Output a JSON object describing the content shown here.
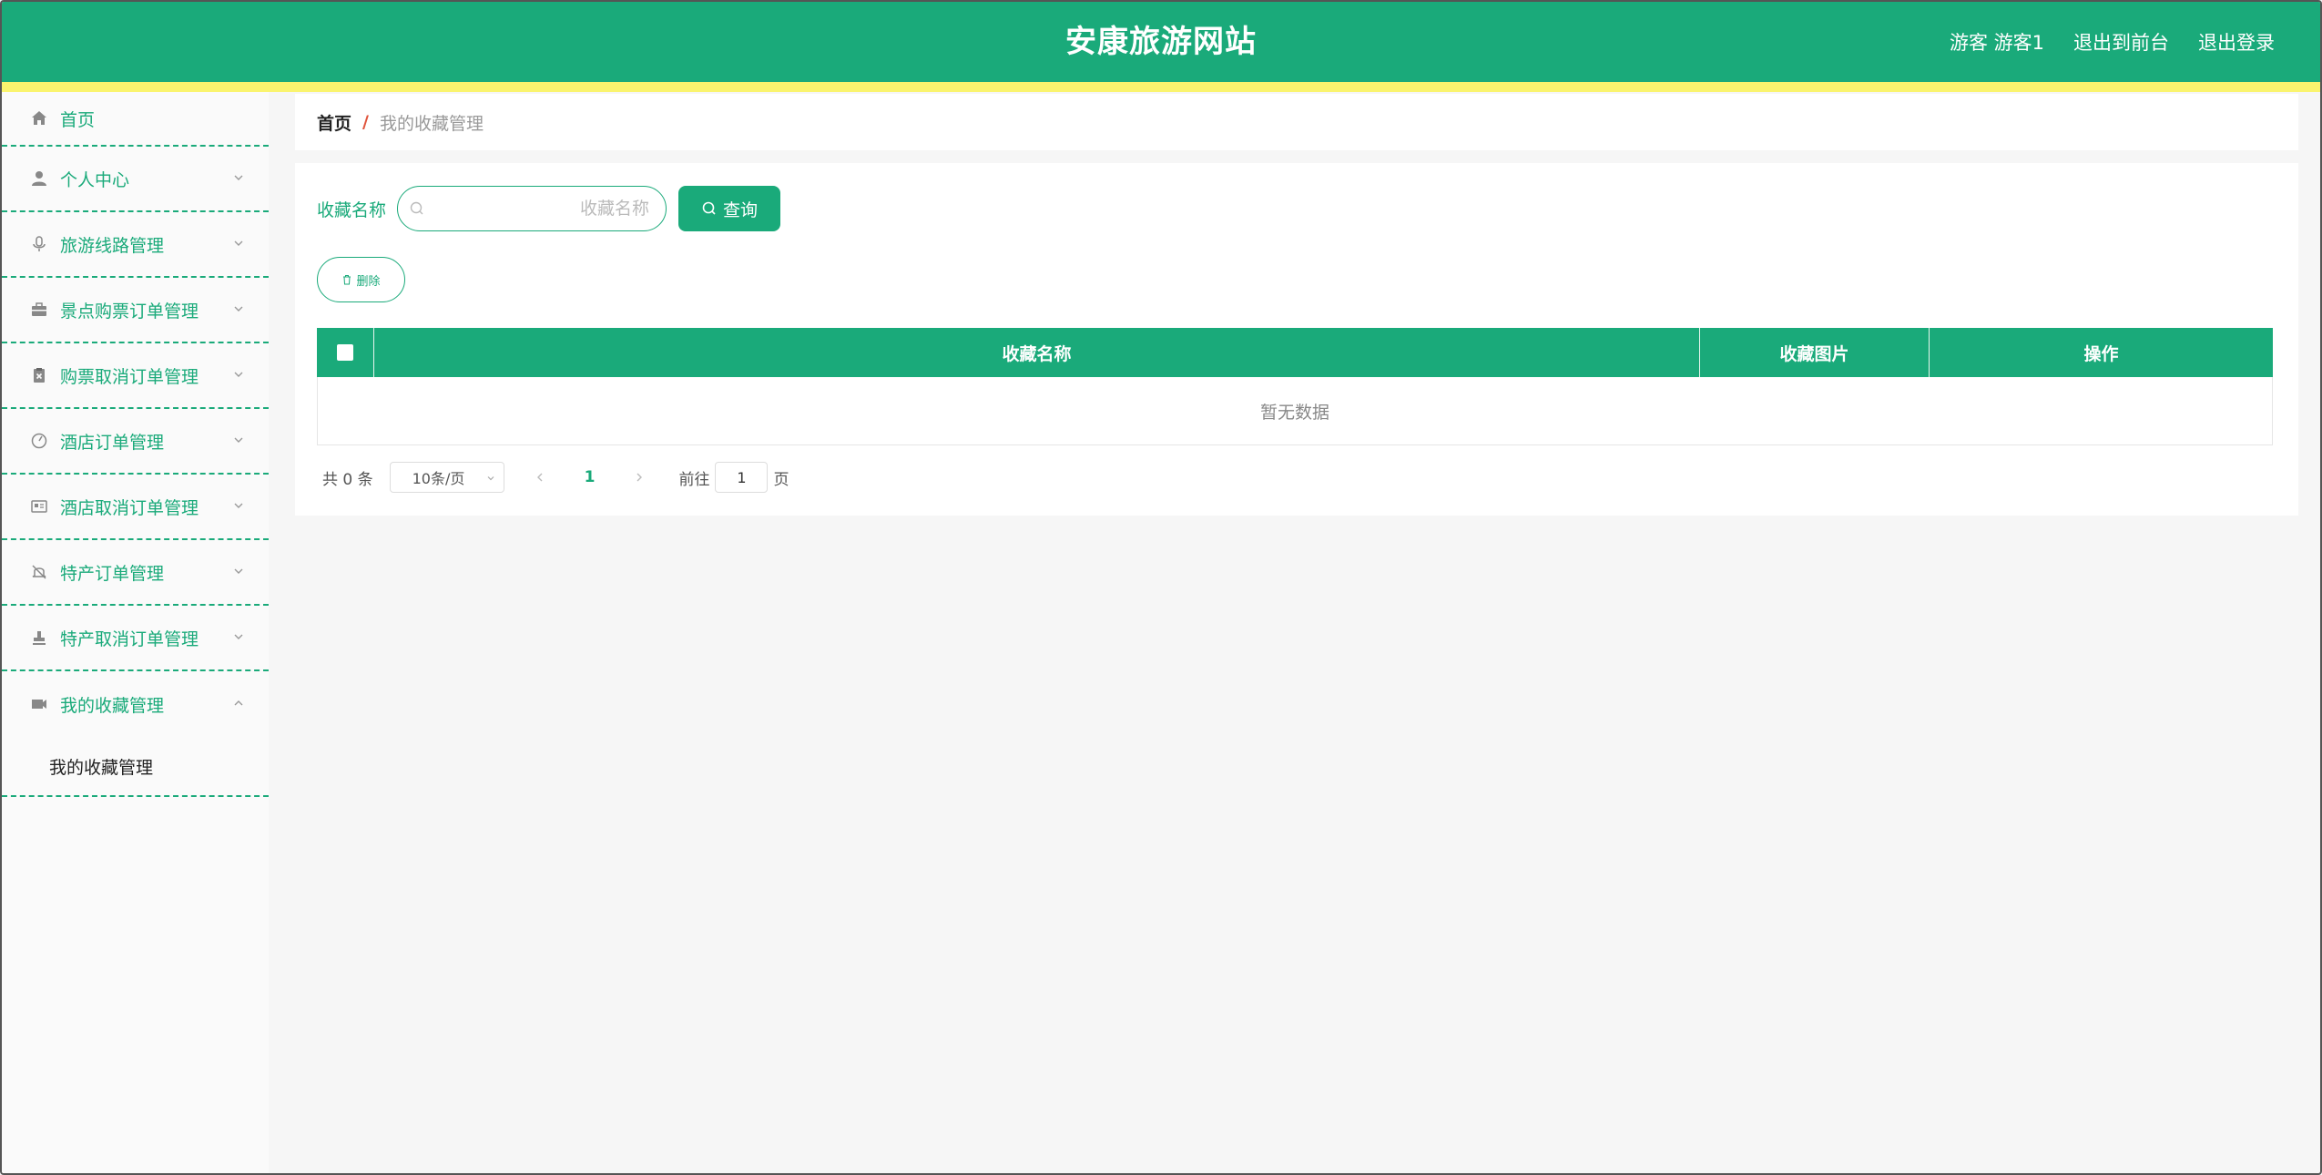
{
  "header": {
    "title": "安康旅游网站",
    "user": "游客 游客1",
    "to_front": "退出到前台",
    "logout": "退出登录",
    "bg_color": "#1aaa7a",
    "stripe_color": "#faf46e"
  },
  "sidebar": {
    "items": [
      {
        "label": "首页",
        "icon": "home-icon"
      },
      {
        "label": "个人中心",
        "icon": "user-icon"
      },
      {
        "label": "旅游线路管理",
        "icon": "microphone-icon"
      },
      {
        "label": "景点购票订单管理",
        "icon": "briefcase-icon"
      },
      {
        "label": "购票取消订单管理",
        "icon": "clipboard-x-icon"
      },
      {
        "label": "酒店订单管理",
        "icon": "gauge-icon"
      },
      {
        "label": "酒店取消订单管理",
        "icon": "id-card-icon"
      },
      {
        "label": "特产订单管理",
        "icon": "bell-off-icon"
      },
      {
        "label": "特产取消订单管理",
        "icon": "stamp-icon"
      },
      {
        "label": "我的收藏管理",
        "icon": "ticket-icon",
        "expanded": true
      }
    ],
    "submenu": {
      "label": "我的收藏管理"
    }
  },
  "breadcrumb": {
    "home": "首页",
    "separator": "/",
    "current": "我的收藏管理"
  },
  "search": {
    "label": "收藏名称",
    "placeholder": "收藏名称",
    "value": "",
    "button": "查询"
  },
  "actions": {
    "delete": "删除"
  },
  "table": {
    "columns": [
      "收藏名称",
      "收藏图片",
      "操作"
    ],
    "empty_text": "暂无数据",
    "rows": []
  },
  "pagination": {
    "total": "共 0 条",
    "page_size": "10条/页",
    "current_page": "1",
    "goto_label": "前往",
    "goto_value": "1",
    "page_suffix": "页"
  }
}
